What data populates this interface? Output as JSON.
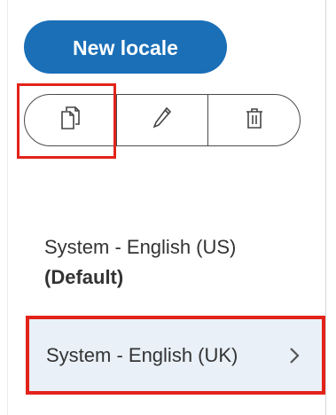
{
  "toolbar": {
    "new_locale_label": "New locale",
    "actions": [
      {
        "name": "copy",
        "icon": "copy-icon"
      },
      {
        "name": "edit",
        "icon": "pencil-icon"
      },
      {
        "name": "delete",
        "icon": "trash-icon"
      }
    ]
  },
  "locales": [
    {
      "label": "System - English (US)",
      "badge": "(Default)",
      "selected": false
    },
    {
      "label": "System - English (UK)",
      "selected": true
    }
  ],
  "colors": {
    "primary": "#1a6fb7",
    "highlight": "#e2231a",
    "selected_bg": "#e9f0f7"
  }
}
